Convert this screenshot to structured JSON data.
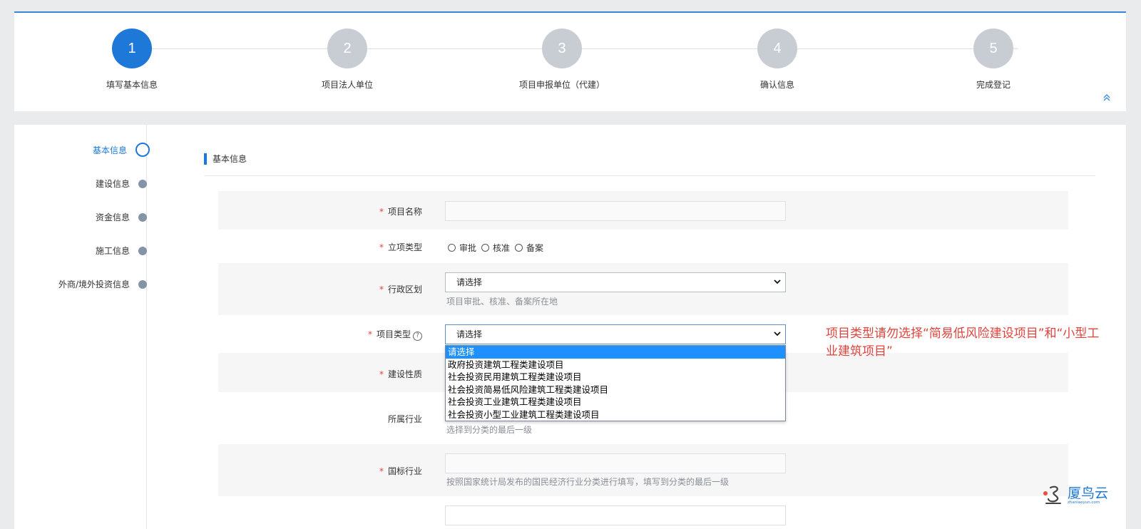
{
  "steps": [
    {
      "number": "1",
      "label": "填写基本信息",
      "active": true
    },
    {
      "number": "2",
      "label": "项目法人单位",
      "active": false
    },
    {
      "number": "3",
      "label": "项目申报单位（代建）",
      "active": false
    },
    {
      "number": "4",
      "label": "确认信息",
      "active": false
    },
    {
      "number": "5",
      "label": "完成登记",
      "active": false
    }
  ],
  "collapse_icon": "double-chevron-up-icon",
  "side_nav": [
    {
      "label": "基本信息",
      "active": true
    },
    {
      "label": "建设信息",
      "active": false
    },
    {
      "label": "资金信息",
      "active": false
    },
    {
      "label": "施工信息",
      "active": false
    },
    {
      "label": "外商/境外投资信息",
      "active": false
    }
  ],
  "section": {
    "title": "基本信息"
  },
  "form": {
    "project_name": {
      "label": "项目名称",
      "required": "*",
      "value": ""
    },
    "approval_type": {
      "label": "立项类型",
      "required": "*",
      "options": [
        "审批",
        "核准",
        "备案"
      ]
    },
    "admin_region": {
      "label": "行政区划",
      "required": "*",
      "value": "请选择",
      "hint": "项目审批、核准、备案所在地"
    },
    "project_type": {
      "label": "项目类型",
      "required": "*",
      "help": "?",
      "value": "请选择",
      "options": [
        "请选择",
        "政府投资建筑工程类建设项目",
        "社会投资民用建筑工程类建设项目",
        "社会投资简易低风险建筑工程类建设项目",
        "社会投资工业建筑工程类建设项目",
        "社会投资小型工业建筑工程类建设项目"
      ]
    },
    "construction_nature": {
      "label": "建设性质",
      "required": "*"
    },
    "industry": {
      "label": "所属行业",
      "hint": "选择到分类的最后一级"
    },
    "national_industry": {
      "label": "国标行业",
      "required": "*",
      "value": "",
      "hint": "按照国家统计局发布的国民经济行业分类进行填写，填写到分类的最后一级"
    }
  },
  "annotation": "项目类型请勿选择“简易低风险建设项目”和“小型工业建筑项目”",
  "watermark": {
    "name": "厦鸟云",
    "domain": "zhaniaoyun.com"
  }
}
